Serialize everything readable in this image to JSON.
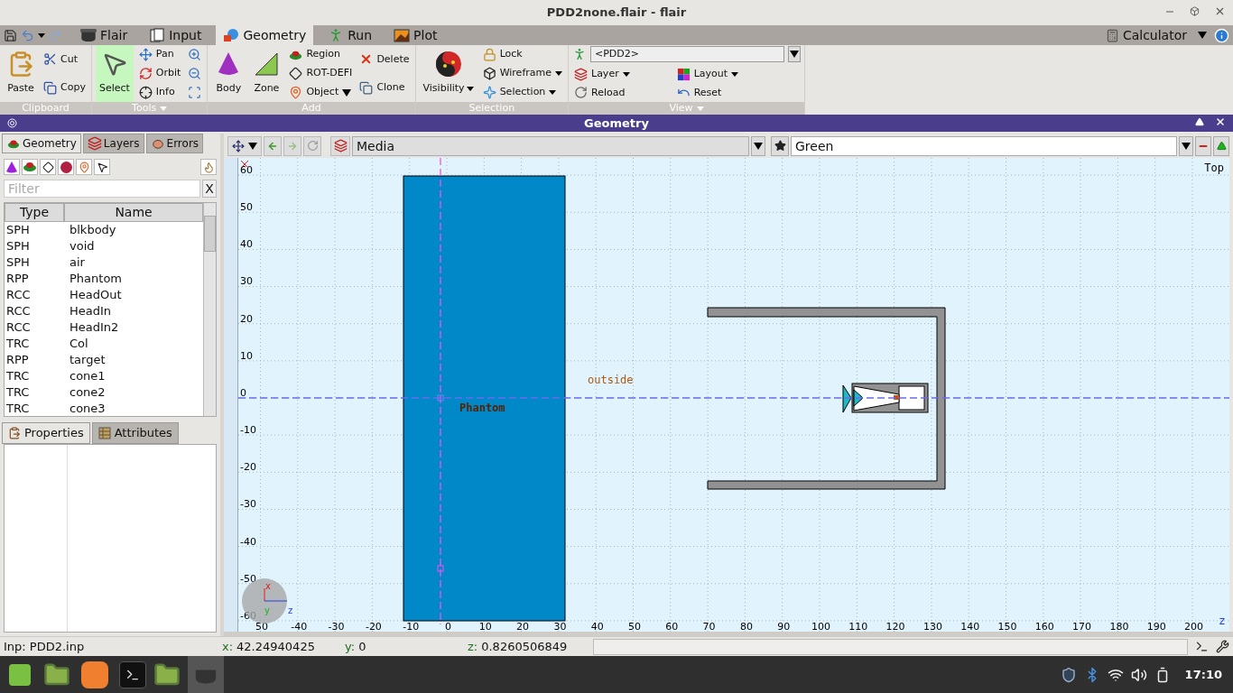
{
  "window": {
    "title": "PDD2none.flair - flair"
  },
  "menu_tabs": [
    {
      "label": "Flair",
      "selected": false
    },
    {
      "label": "Input",
      "selected": false
    },
    {
      "label": "Geometry",
      "selected": true
    },
    {
      "label": "Run",
      "selected": false
    },
    {
      "label": "Plot",
      "selected": false
    }
  ],
  "calculator": {
    "label": "Calculator"
  },
  "ribbon": {
    "groups": [
      {
        "label": "Clipboard",
        "dropdown": false,
        "columns": [
          [
            {
              "kind": "large",
              "label": "Paste"
            }
          ],
          [
            {
              "kind": "small",
              "label": "Cut"
            },
            {
              "kind": "small",
              "label": "Copy"
            }
          ]
        ]
      },
      {
        "label": "Tools",
        "dropdown": true,
        "columns": [
          [
            {
              "kind": "large",
              "label": "Select",
              "selected": true
            }
          ],
          [
            {
              "kind": "small",
              "label": "Pan"
            },
            {
              "kind": "small",
              "label": "Orbit"
            },
            {
              "kind": "small",
              "label": "Info"
            }
          ],
          [
            {
              "kind": "icon"
            },
            {
              "kind": "icon"
            },
            {
              "kind": "icon"
            }
          ]
        ]
      },
      {
        "label": "Add",
        "dropdown": false,
        "columns": [
          [
            {
              "kind": "large",
              "label": "Body"
            }
          ],
          [
            {
              "kind": "large",
              "label": "Zone"
            }
          ],
          [
            {
              "kind": "small",
              "label": "Region"
            },
            {
              "kind": "small",
              "label": "ROT-DEFI"
            },
            {
              "kind": "small",
              "label": "Object",
              "dropdown": true
            }
          ],
          [
            {
              "kind": "small",
              "label": "Delete"
            },
            {
              "kind": "small",
              "label": "Clone"
            }
          ]
        ]
      },
      {
        "label": "Selection",
        "dropdown": false,
        "columns": [
          [
            {
              "kind": "large",
              "label": "Visibility",
              "dropdown": true
            }
          ],
          [
            {
              "kind": "small",
              "label": "Lock"
            },
            {
              "kind": "small",
              "label": "Wireframe",
              "dropdown": true
            },
            {
              "kind": "small",
              "label": "Selection",
              "dropdown": true
            }
          ]
        ]
      },
      {
        "label": "View",
        "dropdown": true,
        "combo": "<PDD2>",
        "columns": [
          [
            {
              "kind": "small",
              "label": "Layer",
              "dropdown": true
            },
            {
              "kind": "small",
              "label": "Reload"
            }
          ],
          [
            {
              "kind": "small",
              "label": "Layout",
              "dropdown": true
            },
            {
              "kind": "small",
              "label": "Reset"
            }
          ]
        ]
      }
    ]
  },
  "panel_title": "Geometry",
  "left_tabs": [
    {
      "label": "Geometry",
      "selected": true
    },
    {
      "label": "Layers",
      "selected": false
    },
    {
      "label": "Errors",
      "selected": false
    }
  ],
  "filter": {
    "placeholder": "Filter",
    "clear": "X"
  },
  "table": {
    "columns": [
      "Type",
      "Name"
    ],
    "rows": [
      [
        "SPH",
        "blkbody"
      ],
      [
        "SPH",
        "void"
      ],
      [
        "SPH",
        "air"
      ],
      [
        "RPP",
        "Phantom"
      ],
      [
        "RCC",
        "HeadOut"
      ],
      [
        "RCC",
        "HeadIn"
      ],
      [
        "RCC",
        "HeadIn2"
      ],
      [
        "TRC",
        "Col"
      ],
      [
        "RPP",
        "target"
      ],
      [
        "TRC",
        "cone1"
      ],
      [
        "TRC",
        "cone2"
      ],
      [
        "TRC",
        "cone3"
      ]
    ]
  },
  "lower_tabs": [
    {
      "label": "Properties",
      "selected": true
    },
    {
      "label": "Attributes",
      "selected": false
    }
  ],
  "viewport": {
    "layer_combo": "Media",
    "color_combo": "Green",
    "view_name": "Top",
    "x_ticks": [
      "50",
      "-40",
      "-30",
      "-20",
      "-10",
      "0",
      "10",
      "20",
      "30",
      "40",
      "50",
      "60",
      "70",
      "80",
      "90",
      "100",
      "110",
      "120",
      "130",
      "140",
      "150",
      "160",
      "170",
      "180",
      "190",
      "200"
    ],
    "y_ticks": [
      "60",
      "50",
      "40",
      "30",
      "20",
      "10",
      "0",
      "-10",
      "-20",
      "-30",
      "-40",
      "-50",
      "-60"
    ],
    "x_axis_name": "z",
    "orientation_axes": [
      "x",
      "y",
      "z"
    ],
    "region_labels": [
      "outside",
      "Phantom"
    ]
  },
  "status_bar": {
    "input": "Inp: PDD2.inp",
    "coords": [
      {
        "label": "x:",
        "value": "42.24940425"
      },
      {
        "label": "y:",
        "value": "0"
      },
      {
        "label": "z:",
        "value": "0.8260506849"
      }
    ]
  },
  "taskbar": {
    "clock": "17:10"
  }
}
